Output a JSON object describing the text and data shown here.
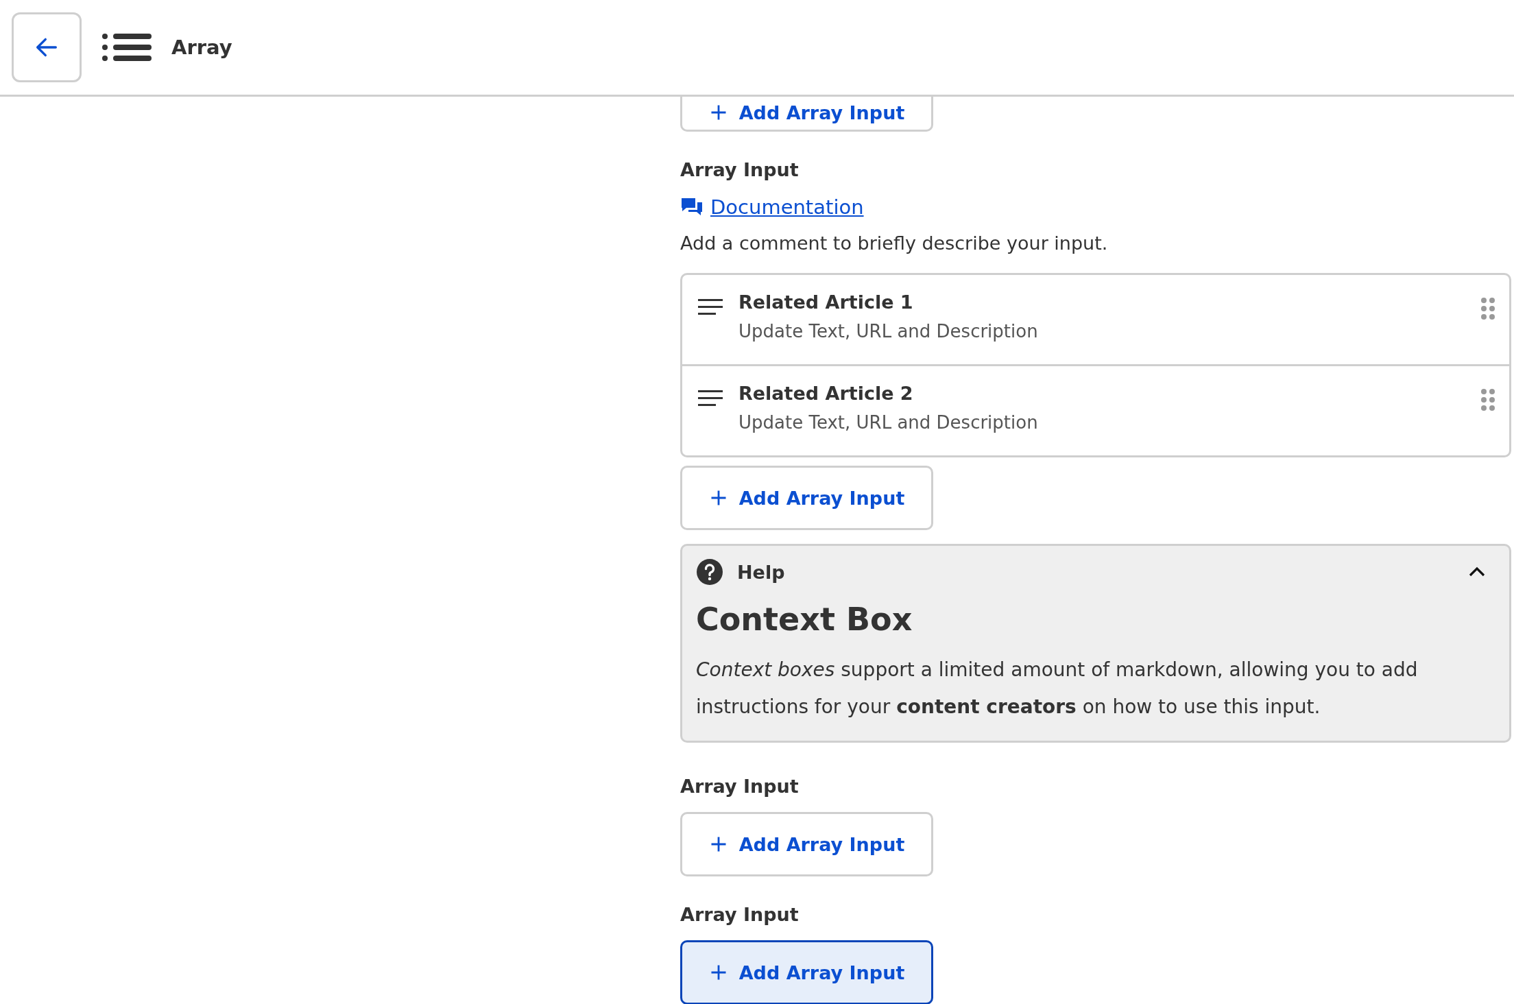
{
  "header": {
    "title": "Array"
  },
  "blocks": [
    {
      "kind": "add",
      "button": {
        "label": "Add Array Input",
        "selected": false
      }
    },
    {
      "kind": "field",
      "label": "Array Input",
      "link": "Documentation",
      "description": "Add a comment to briefly describe your input.",
      "items": [
        {
          "title": "Related Article 1",
          "subtitle": "Update Text, URL and Description"
        },
        {
          "title": "Related Article 2",
          "subtitle": "Update Text, URL and Description"
        }
      ],
      "button": {
        "label": "Add Array Input",
        "selected": false
      }
    },
    {
      "kind": "help",
      "label": "Help",
      "expanded": true,
      "heading": "Context Box",
      "body": "*Context boxes* support a limited amount of markdown, allowing you to add instructions for your **content creators** on how to use this input."
    },
    {
      "kind": "field",
      "label": "Array Input",
      "button": {
        "label": "Add Array Input",
        "selected": false
      }
    },
    {
      "kind": "field",
      "label": "Array Input",
      "button": {
        "label": "Add Array Input",
        "selected": true
      }
    }
  ]
}
